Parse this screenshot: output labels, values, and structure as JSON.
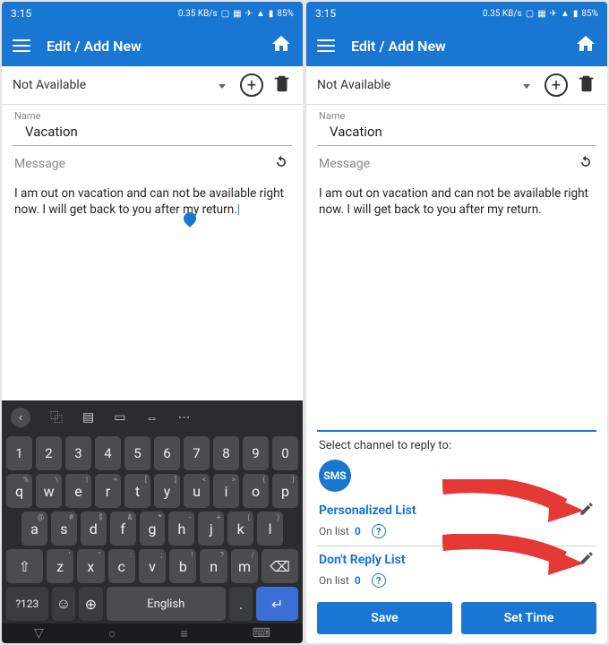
{
  "status": {
    "time": "3:15",
    "net": "0.35 KB/s",
    "battery": "85%"
  },
  "appbar": {
    "title": "Edit / Add New"
  },
  "dropdown": {
    "value": "Not Available"
  },
  "name": {
    "label": "Name",
    "value": "Vacation"
  },
  "message": {
    "label": "Message",
    "text": "I am out on vacation and can not be available right now. I will get back to you after my return."
  },
  "keyboard": {
    "nums": [
      "1",
      "2",
      "3",
      "4",
      "5",
      "6",
      "7",
      "8",
      "9",
      "0"
    ],
    "row1": [
      "q",
      "w",
      "e",
      "r",
      "t",
      "y",
      "u",
      "i",
      "o",
      "p"
    ],
    "row1sup": [
      "%",
      "\\",
      "|",
      "=",
      "[",
      "]",
      "<",
      ">",
      "{",
      "}"
    ],
    "row2": [
      "a",
      "s",
      "d",
      "f",
      "g",
      "h",
      "j",
      "k",
      "l"
    ],
    "row2sup": [
      "@",
      "#",
      "$",
      "&",
      "*",
      "-",
      "+",
      "(",
      ")"
    ],
    "row3": [
      "z",
      "x",
      "c",
      "v",
      "b",
      "n",
      "m"
    ],
    "row3sup": [
      "'",
      "\"",
      ":",
      ";",
      "!",
      "?",
      "/"
    ],
    "symkey": "?123",
    "space": "English"
  },
  "right": {
    "channel_label": "Select channel to reply to:",
    "sms": "SMS",
    "personalized": {
      "title": "Personalized List",
      "onlist": "On list",
      "count": "0"
    },
    "dontreply": {
      "title": "Don't Reply List",
      "onlist": "On list",
      "count": "0"
    },
    "save": "Save",
    "settime": "Set Time"
  }
}
